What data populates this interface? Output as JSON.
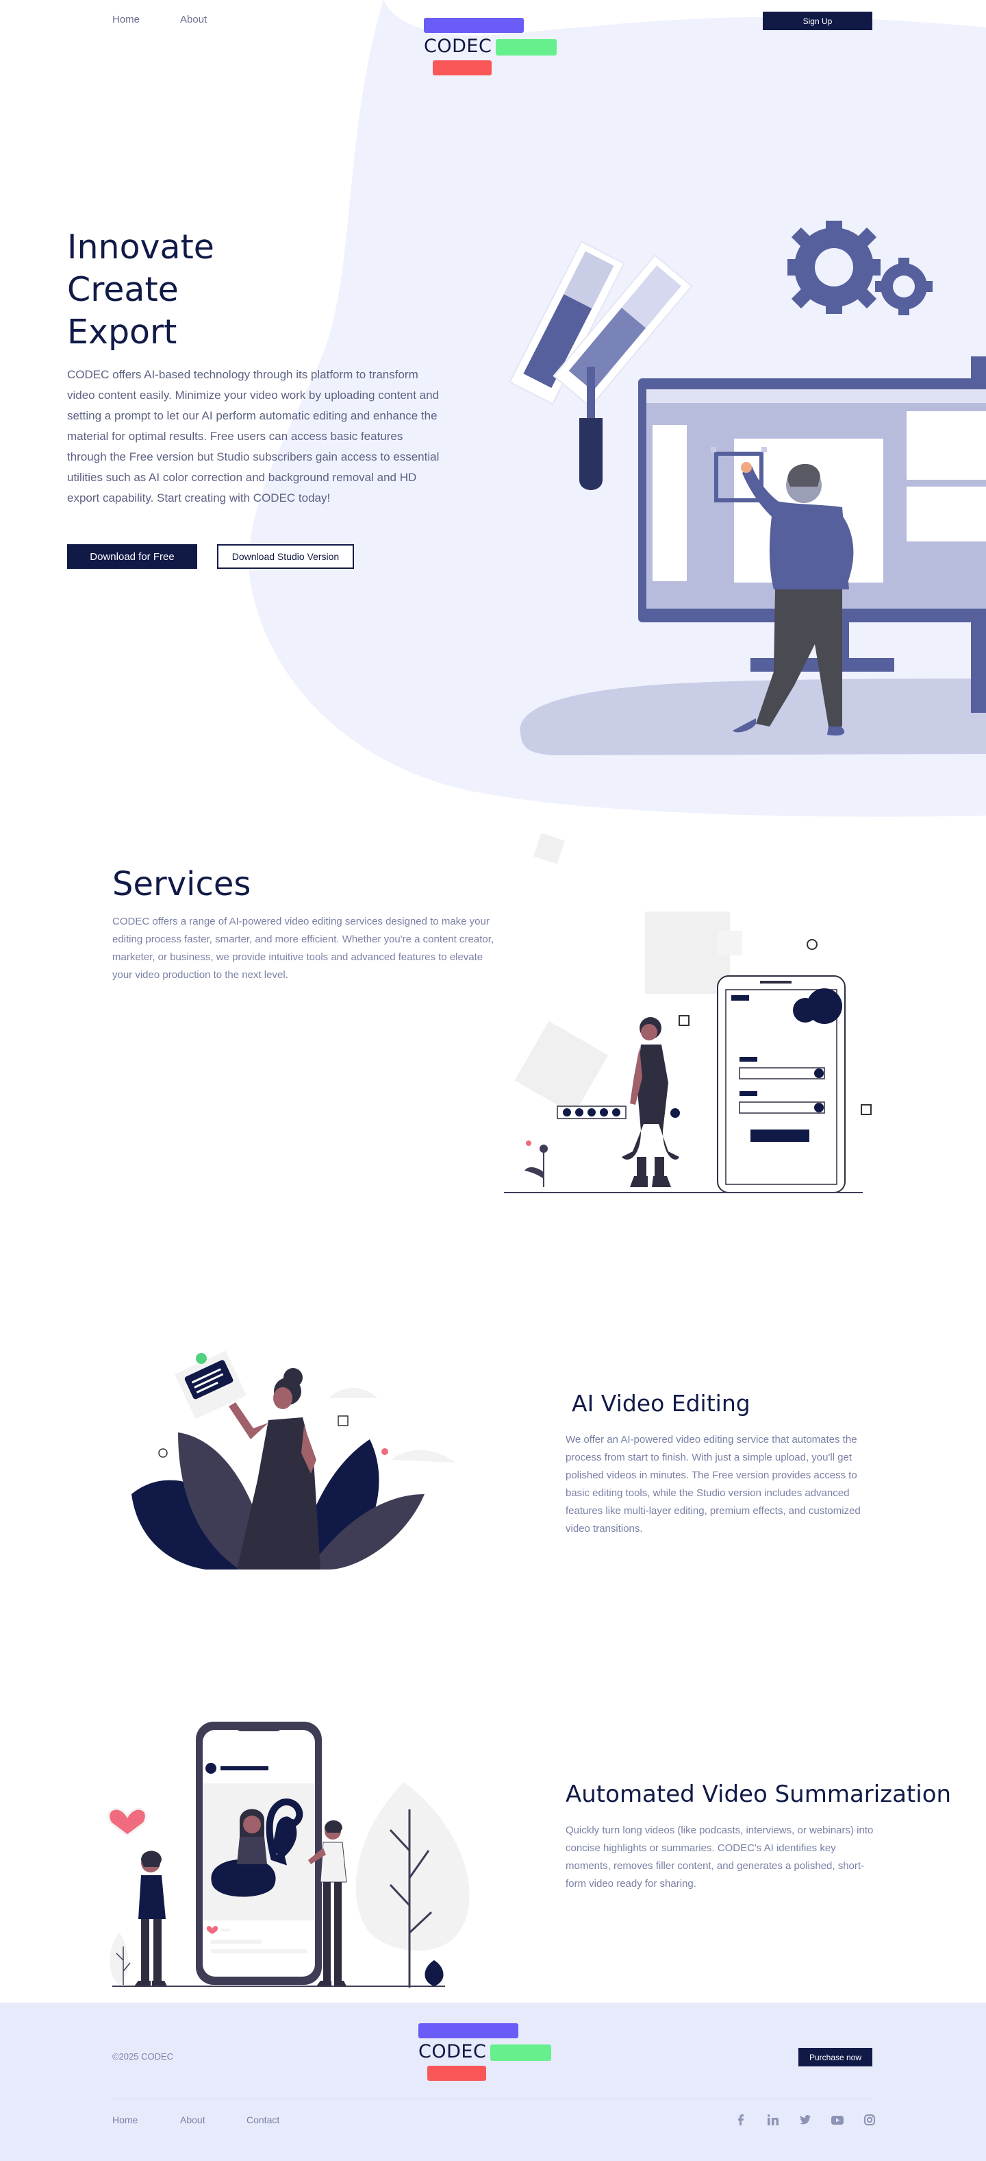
{
  "header": {
    "nav": [
      {
        "label": "Home"
      },
      {
        "label": "About"
      }
    ],
    "logo_text": "CODEC",
    "signup_label": "Sign Up"
  },
  "hero": {
    "title_lines": [
      "Innovate",
      "Create",
      "Export"
    ],
    "description": "CODEC offers AI-based technology through its platform to transform video content easily. Minimize your video work by uploading content and setting a prompt to let our AI perform automatic editing and enhance the material for optimal results. Free users can access basic features through the Free version but Studio subscribers gain access to essential utilities such as AI color correction and background removal and HD export capability. Start creating with CODEC today!",
    "primary_button": "Download for Free",
    "secondary_button": "Download Studio Version"
  },
  "services": {
    "title": "Services",
    "description": "CODEC offers a range of AI-powered video editing services designed to make your editing process faster, smarter, and more efficient. Whether you're a content creator, marketer, or business, we provide intuitive tools and advanced features to elevate your video production to the next level."
  },
  "ai_editing": {
    "title": "AI Video Editing",
    "description": "We offer an AI-powered video editing service that automates the process from start to finish. With just a simple upload, you'll get polished videos in minutes. The Free version provides access to basic editing tools, while the Studio version includes advanced features like multi-layer editing, premium effects, and customized video transitions."
  },
  "summarization": {
    "title": "Automated Video Summarization",
    "description": "Quickly turn long videos (like podcasts, interviews, or webinars) into concise highlights or summaries. CODEC's AI identifies key moments, removes filler content, and generates a polished, short-form video ready for sharing."
  },
  "footer": {
    "copyright": "©2025 CODEC",
    "logo_text": "CODEC",
    "purchase_label": "Purchase now",
    "links": [
      {
        "label": "Home"
      },
      {
        "label": "About"
      },
      {
        "label": "Contact"
      }
    ],
    "social_icons": [
      "facebook-icon",
      "linkedin-icon",
      "twitter-icon",
      "youtube-icon",
      "instagram-icon"
    ]
  },
  "colors": {
    "navy": "#111a47",
    "blob": "#eff1fd",
    "accent_purple": "#6a5cf6",
    "accent_green": "#66f08d",
    "accent_red": "#f95757",
    "illustration_blue": "#56609c",
    "footer_bg": "#e7eafb"
  }
}
